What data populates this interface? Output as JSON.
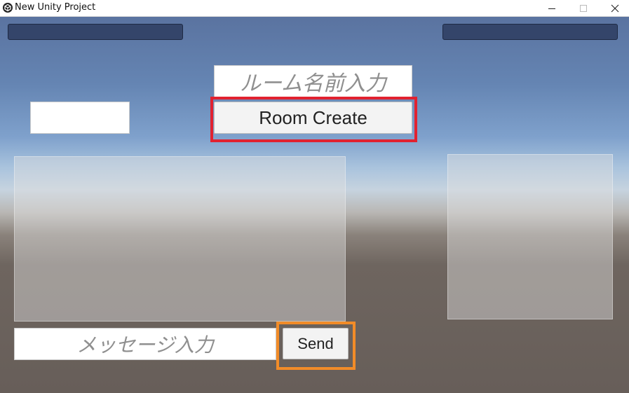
{
  "window": {
    "title": "New Unity Project",
    "icon": "unity-logo-icon",
    "controls": [
      "minimize-icon",
      "maximize-icon",
      "close-icon"
    ]
  },
  "scene": {
    "room_name_input": {
      "value": "",
      "placeholder": "ルーム名前入力"
    },
    "room_create_button": {
      "label": "Room Create"
    },
    "message_input": {
      "value": "",
      "placeholder": "メッセージ入力"
    },
    "send_button": {
      "label": "Send"
    }
  },
  "colors": {
    "top_bar": "#34456a",
    "room_create_highlight": "#e12230",
    "send_highlight": "#f28c28"
  }
}
